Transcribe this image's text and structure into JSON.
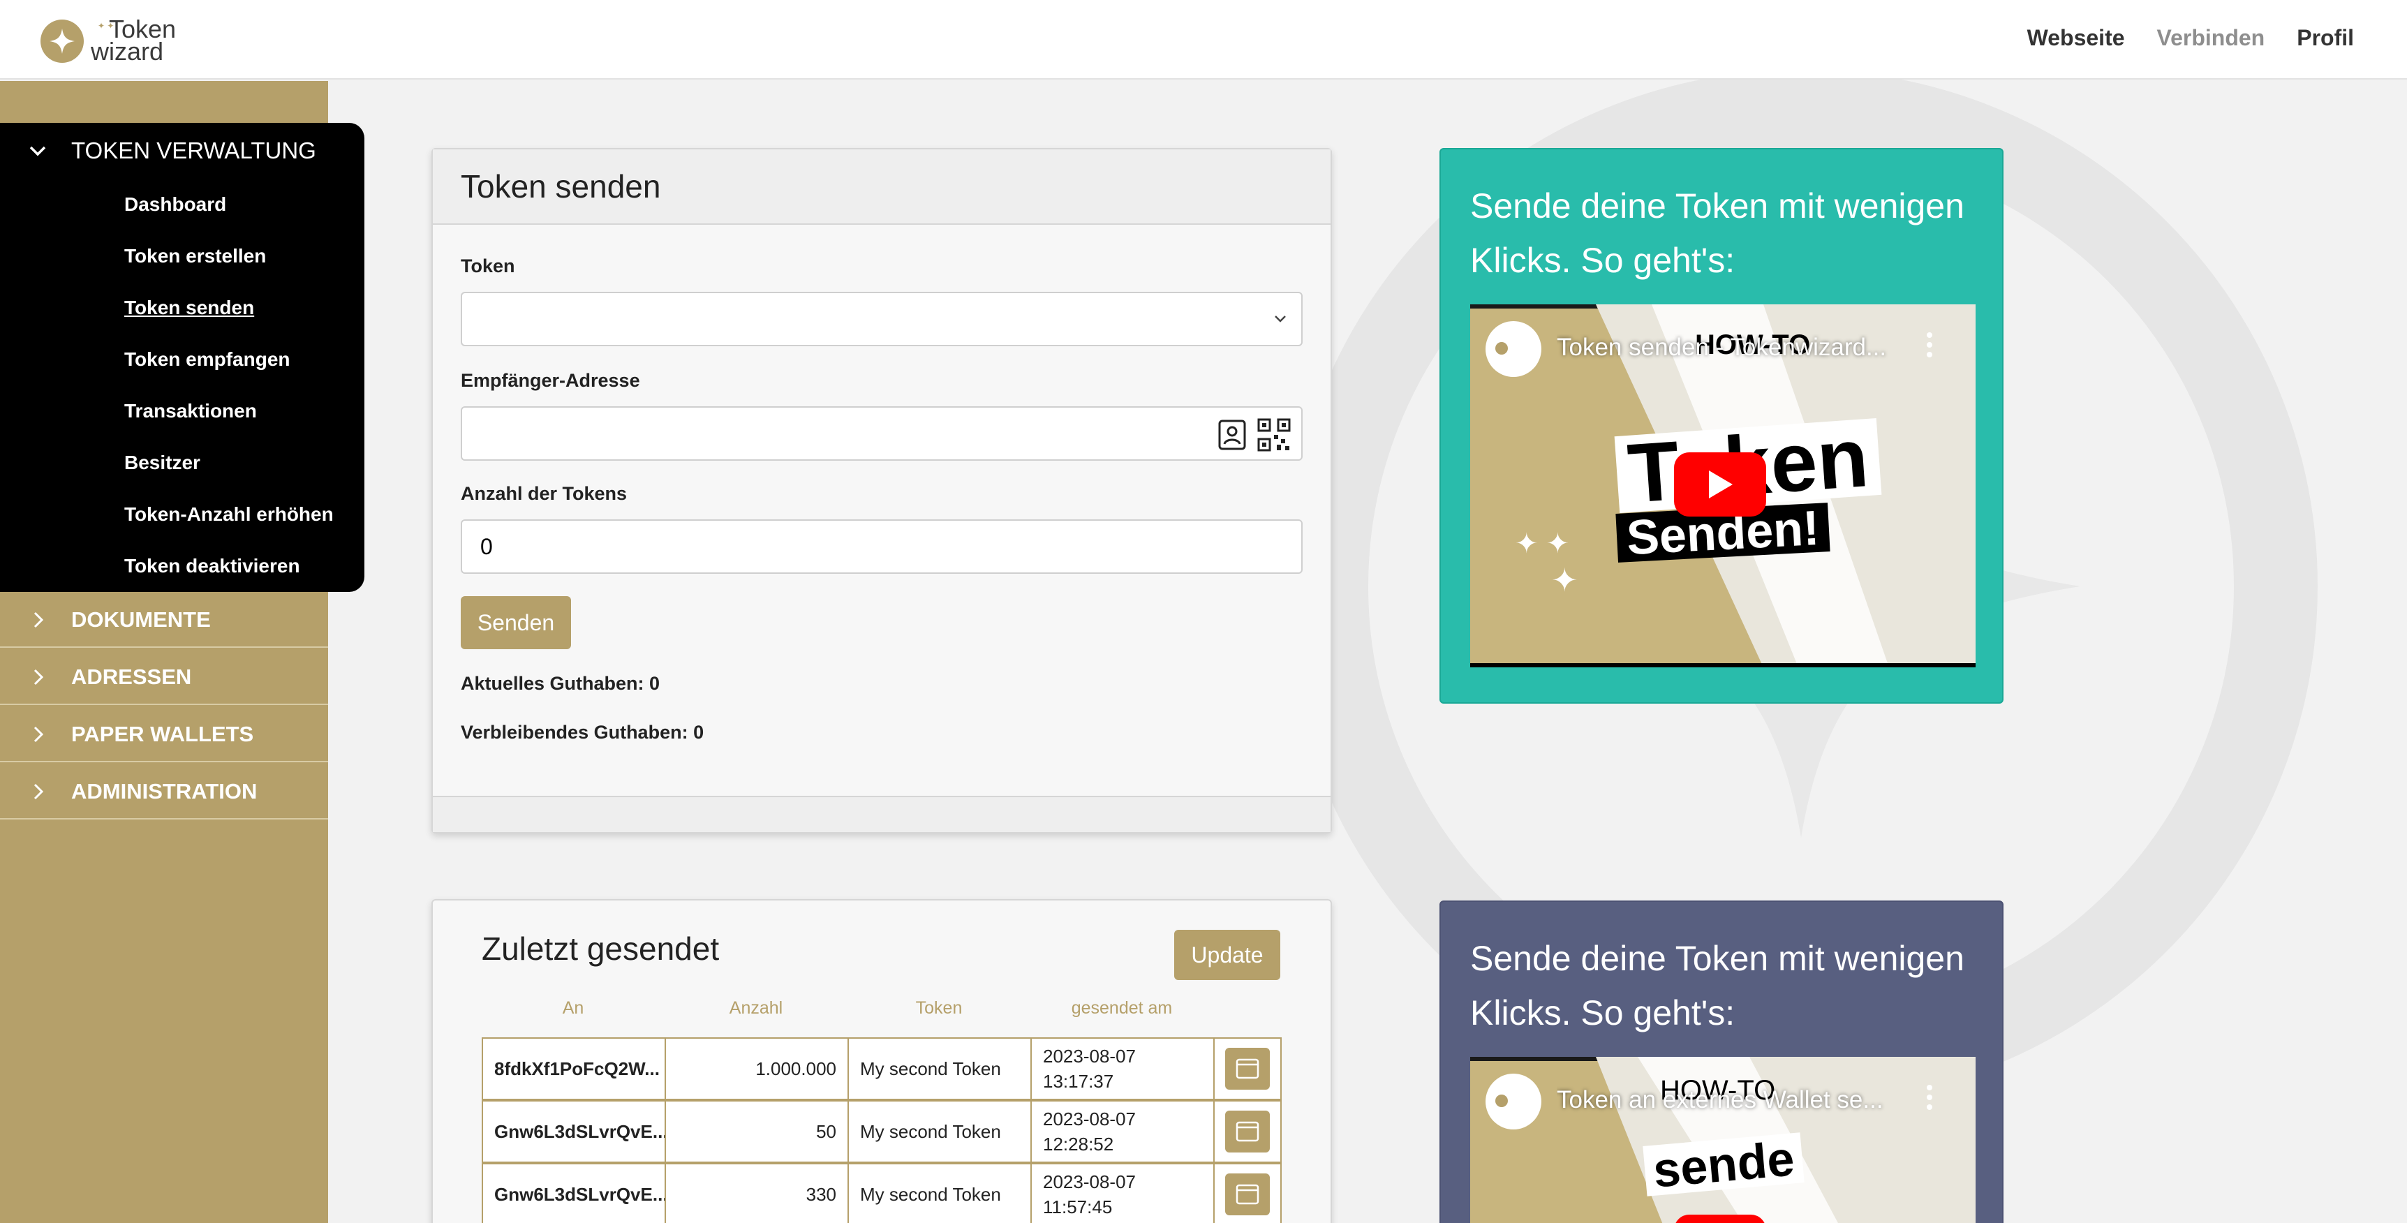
{
  "header": {
    "logo_line1": "Token",
    "logo_line2": "wizard",
    "nav": [
      "Webseite",
      "Verbinden",
      "Profil"
    ]
  },
  "sidebar": {
    "active_section": "TOKEN VERWALTUNG",
    "sub_items": [
      "Dashboard",
      "Token erstellen",
      "Token senden",
      "Token empfangen",
      "Transaktionen",
      "Besitzer",
      "Token-Anzahl erhöhen",
      "Token deaktivieren"
    ],
    "sections": [
      "DOKUMENTE",
      "ADRESSEN",
      "PAPER WALLETS",
      "ADMINISTRATION"
    ]
  },
  "send_form": {
    "title": "Token senden",
    "token_label": "Token",
    "token_value": "",
    "recipient_label": "Empfänger-Adresse",
    "recipient_value": "",
    "amount_label": "Anzahl der Tokens",
    "amount_value": "0",
    "send_button": "Senden",
    "current_balance": "Aktuelles Guthaben: 0",
    "remaining_balance": "Verbleibendes Guthaben: 0"
  },
  "recent": {
    "title": "Zuletzt gesendet",
    "update_button": "Update",
    "headers": [
      "An",
      "Anzahl",
      "Token",
      "gesendet am"
    ],
    "rows": [
      {
        "to": "8fdkXf1PoFcQ2W...",
        "amount": "1.000.000",
        "token": "My second Token",
        "date": "2023-08-07",
        "time": "13:17:37"
      },
      {
        "to": "Gnw6L3dSLvrQvE...",
        "amount": "50",
        "token": "My second Token",
        "date": "2023-08-07",
        "time": "12:28:52"
      },
      {
        "to": "Gnw6L3dSLvrQvE...",
        "amount": "330",
        "token": "My second Token",
        "date": "2023-08-07",
        "time": "11:57:45"
      }
    ]
  },
  "video_cards": [
    {
      "text": "Sende deine Token mit wenigen Klicks. So geht's:",
      "video_title": "Token senden - Tokenwizard...",
      "overlay_top": "HOW-TO",
      "overlay_main": "Token",
      "overlay_sub": "Senden!",
      "bg_color": "#29bcab"
    },
    {
      "text": "Sende deine Token mit wenigen Klicks. So geht's:",
      "video_title": "Token an externes Wallet se...",
      "overlay_top": "HOW-TO",
      "overlay_main": "sende",
      "bg_color": "#585f80"
    }
  ],
  "colors": {
    "accent_gold": "#b5a06a",
    "teal": "#29bcab",
    "slate": "#585f80"
  },
  "icons": [
    "chevron-down-icon",
    "chevron-right-icon",
    "contact-book-icon",
    "qr-code-icon",
    "calendar-icon",
    "play-icon",
    "more-vert-icon",
    "sparkle-icon"
  ]
}
